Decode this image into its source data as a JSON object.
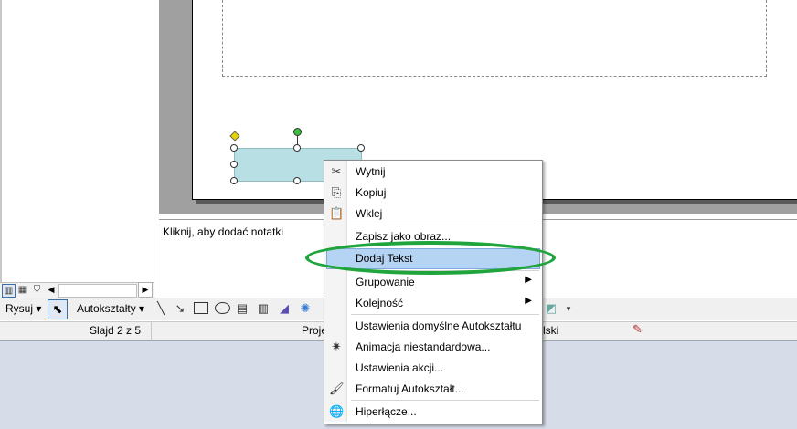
{
  "notes": {
    "placeholder": "Kliknij, aby dodać notatki"
  },
  "draw_toolbar": {
    "draw_label": "Rysuj ▾",
    "autoshapes_label": "Autokształty ▾",
    "icons": [
      "select-pointer",
      "line",
      "arrow",
      "rectangle",
      "oval",
      "text-box",
      "vertical-text-box",
      "wordart",
      "diagram",
      "fill-color",
      "3d-style"
    ]
  },
  "status_bar": {
    "slide_info": "Slajd 2 z 5",
    "design": "Proje",
    "language": "lski"
  },
  "context_menu": {
    "items": [
      {
        "label": "Wytnij",
        "icon": "scissors-icon"
      },
      {
        "label": "Kopiuj",
        "icon": "copy-icon"
      },
      {
        "label": "Wklej",
        "icon": "paste-icon"
      },
      {
        "label": "Zapisz jako obraz..."
      },
      {
        "label": "Dodaj Tekst",
        "highlighted": true
      },
      {
        "label": "Grupowanie",
        "submenu": true
      },
      {
        "label": "Kolejność",
        "submenu": true
      },
      {
        "label": "Ustawienia domyślne Autokształtu"
      },
      {
        "label": "Animacja niestandardowa...",
        "icon": "animation-icon"
      },
      {
        "label": "Ustawienia akcji..."
      },
      {
        "label": "Formatuj Autokształt...",
        "icon": "format-icon"
      },
      {
        "label": "Hiperłącze...",
        "icon": "hyperlink-icon"
      }
    ]
  },
  "colors": {
    "highlight_ellipse": "#1fa53b",
    "menu_highlight": "#b5d3f2",
    "shape_fill": "#b8dfe4"
  }
}
